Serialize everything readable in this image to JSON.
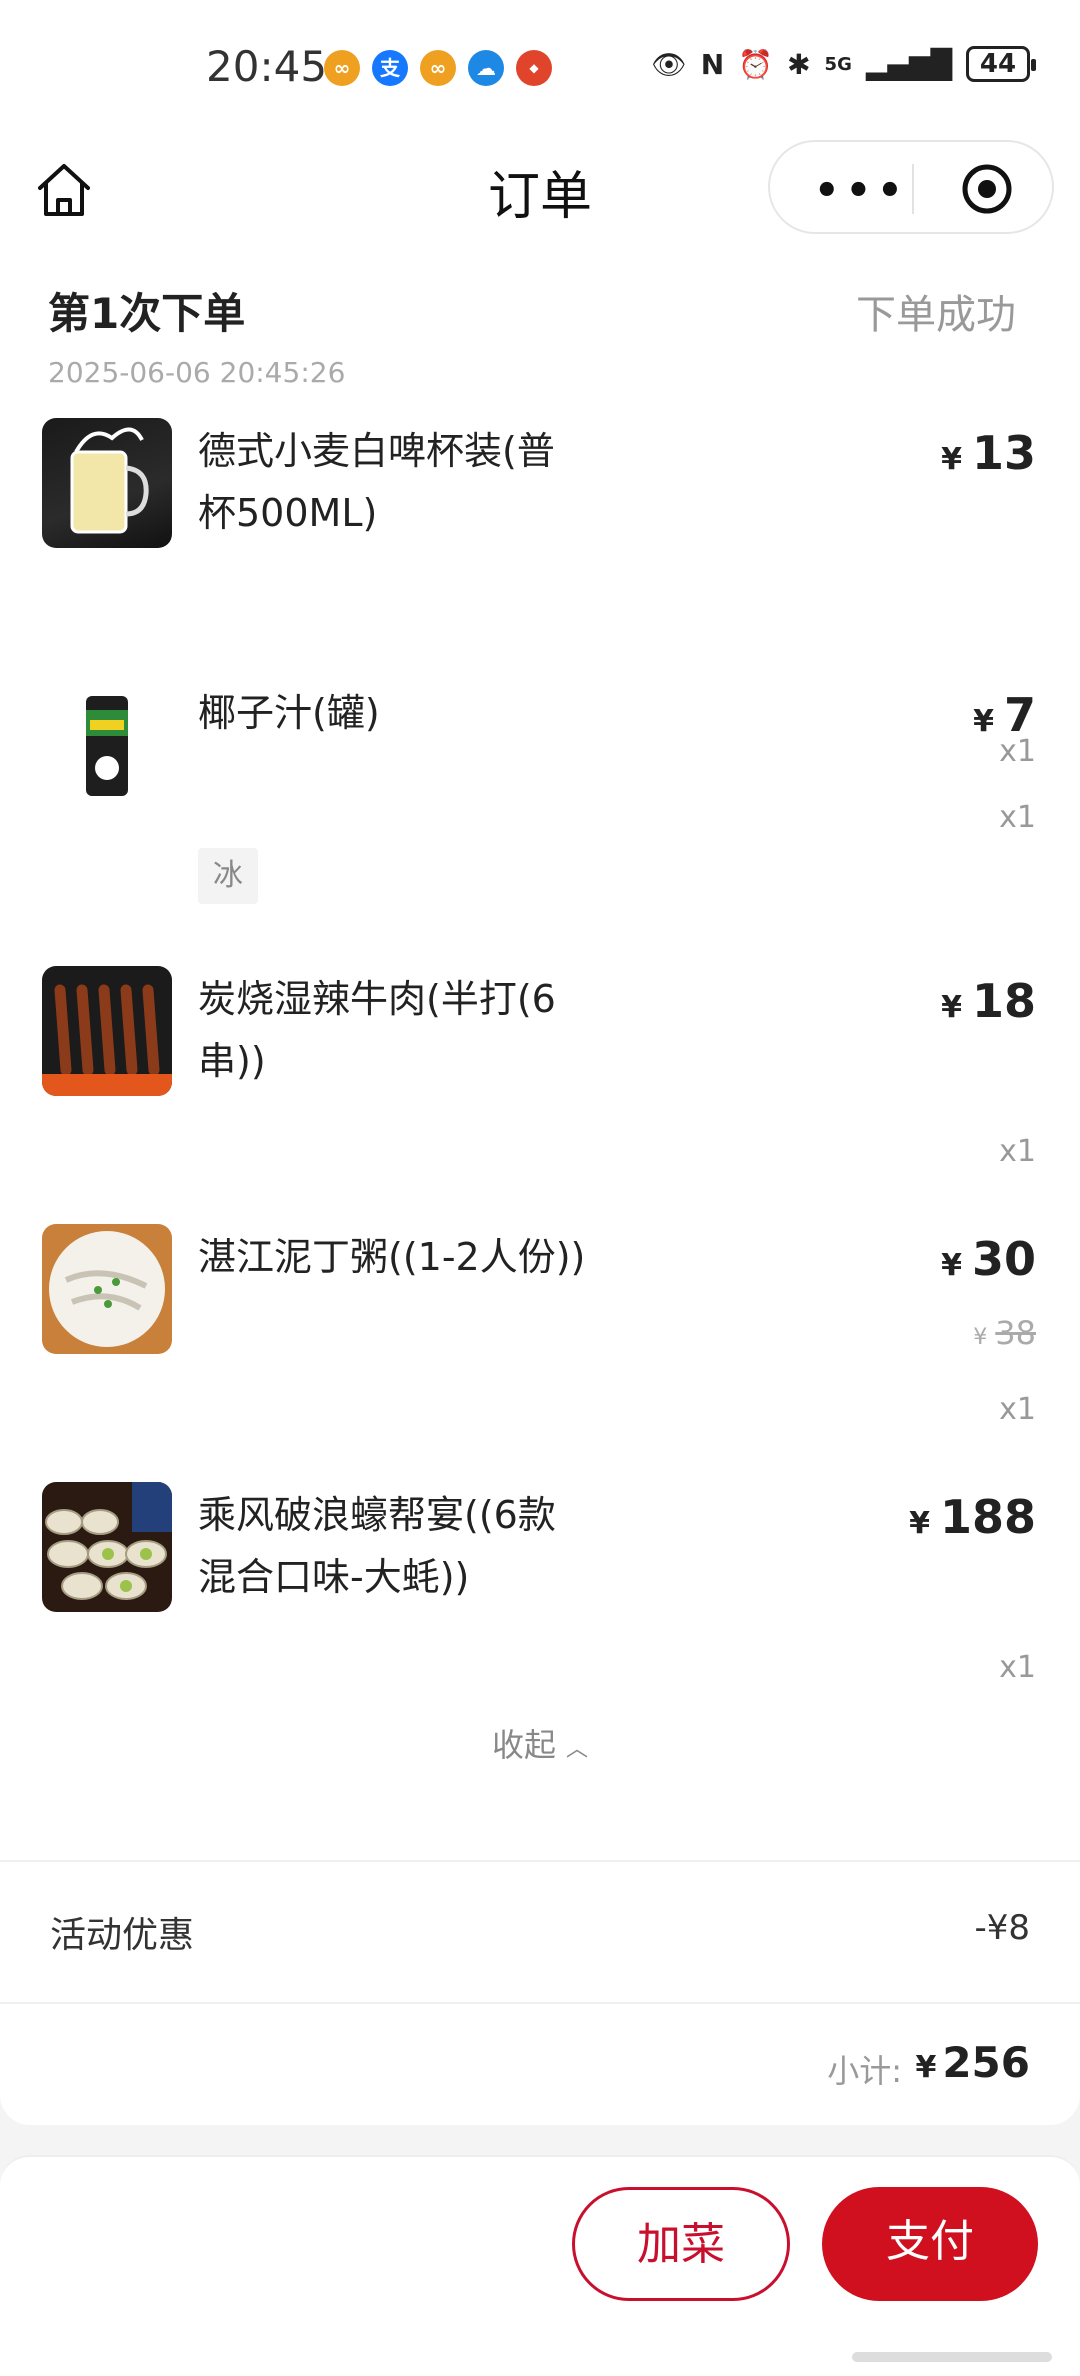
{
  "status_bar": {
    "time": "20:45",
    "network": "5G",
    "battery": "44"
  },
  "nav": {
    "title": "订单"
  },
  "order": {
    "title": "第1次下单",
    "status": "下单成功",
    "time": "2025-06-06 20:45:26",
    "items": [
      {
        "name": "德式小麦白啤杯装(普杯500ML)",
        "price": "13",
        "qty": "x1"
      },
      {
        "name": "椰子汁(罐)",
        "price": "7",
        "qty": "x1",
        "spec": "冰"
      },
      {
        "name": "炭烧湿辣牛肉(半打(6串))",
        "price": "18",
        "qty": "x1"
      },
      {
        "name": "湛江泥丁粥((1-2人份))",
        "price": "30",
        "original_price": "38",
        "qty": "x1"
      },
      {
        "name": "乘风破浪蠔帮宴((6款混合口味-大蚝))",
        "price": "188",
        "qty": "x1"
      }
    ],
    "currency": "¥",
    "collapse_label": "收起",
    "discount_label": "活动优惠",
    "discount_value": "-¥8",
    "subtotal_label": "小计:",
    "subtotal_value": "256"
  },
  "actions": {
    "add_label": "加菜",
    "pay_label": "支付"
  },
  "colors": {
    "accent": "#d0101f"
  }
}
